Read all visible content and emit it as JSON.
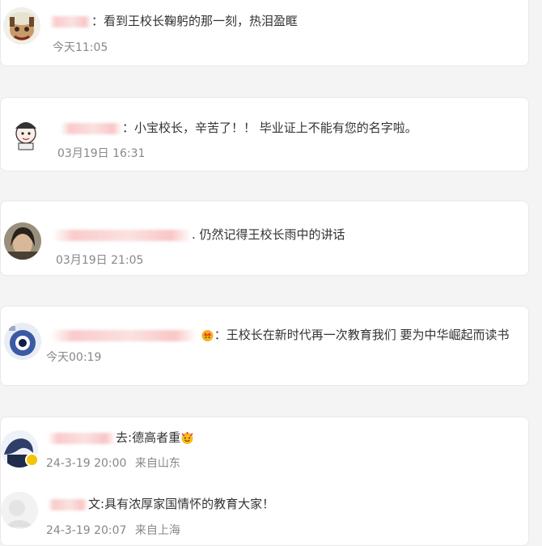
{
  "comments": [
    {
      "text": "：看到王校长鞠躬的那一刻，热泪盈眶",
      "time": "今天11:05"
    },
    {
      "text": "：小宝校长，辛苦了！！ 毕业证上不能有您的名字啦。",
      "time": "03月19日 16:31"
    },
    {
      "text": ". 仍然记得王校长雨中的讲话",
      "time": "03月19日 21:05"
    },
    {
      "text": "：王校长在新时代再一次教育我们 要为中华崛起而读书",
      "time": "今天00:19"
    },
    {
      "text": "德高者重",
      "time": "24-3-19 20:00",
      "location": "来自山东"
    },
    {
      "text": "具有浓厚家国情怀的教育大家！",
      "time": "24-3-19 20:07",
      "location": "来自上海"
    }
  ],
  "nick_suffix_4": "去:",
  "nick_suffix_5": "文:",
  "icons": {
    "verified_badge": "verified-badge-icon",
    "crown": "crown-emoji",
    "celebrate": "celebrate-emoji"
  },
  "colors": {
    "badge": "#f5c400",
    "time": "#888888",
    "blur_nick": "#f5a0a0"
  }
}
